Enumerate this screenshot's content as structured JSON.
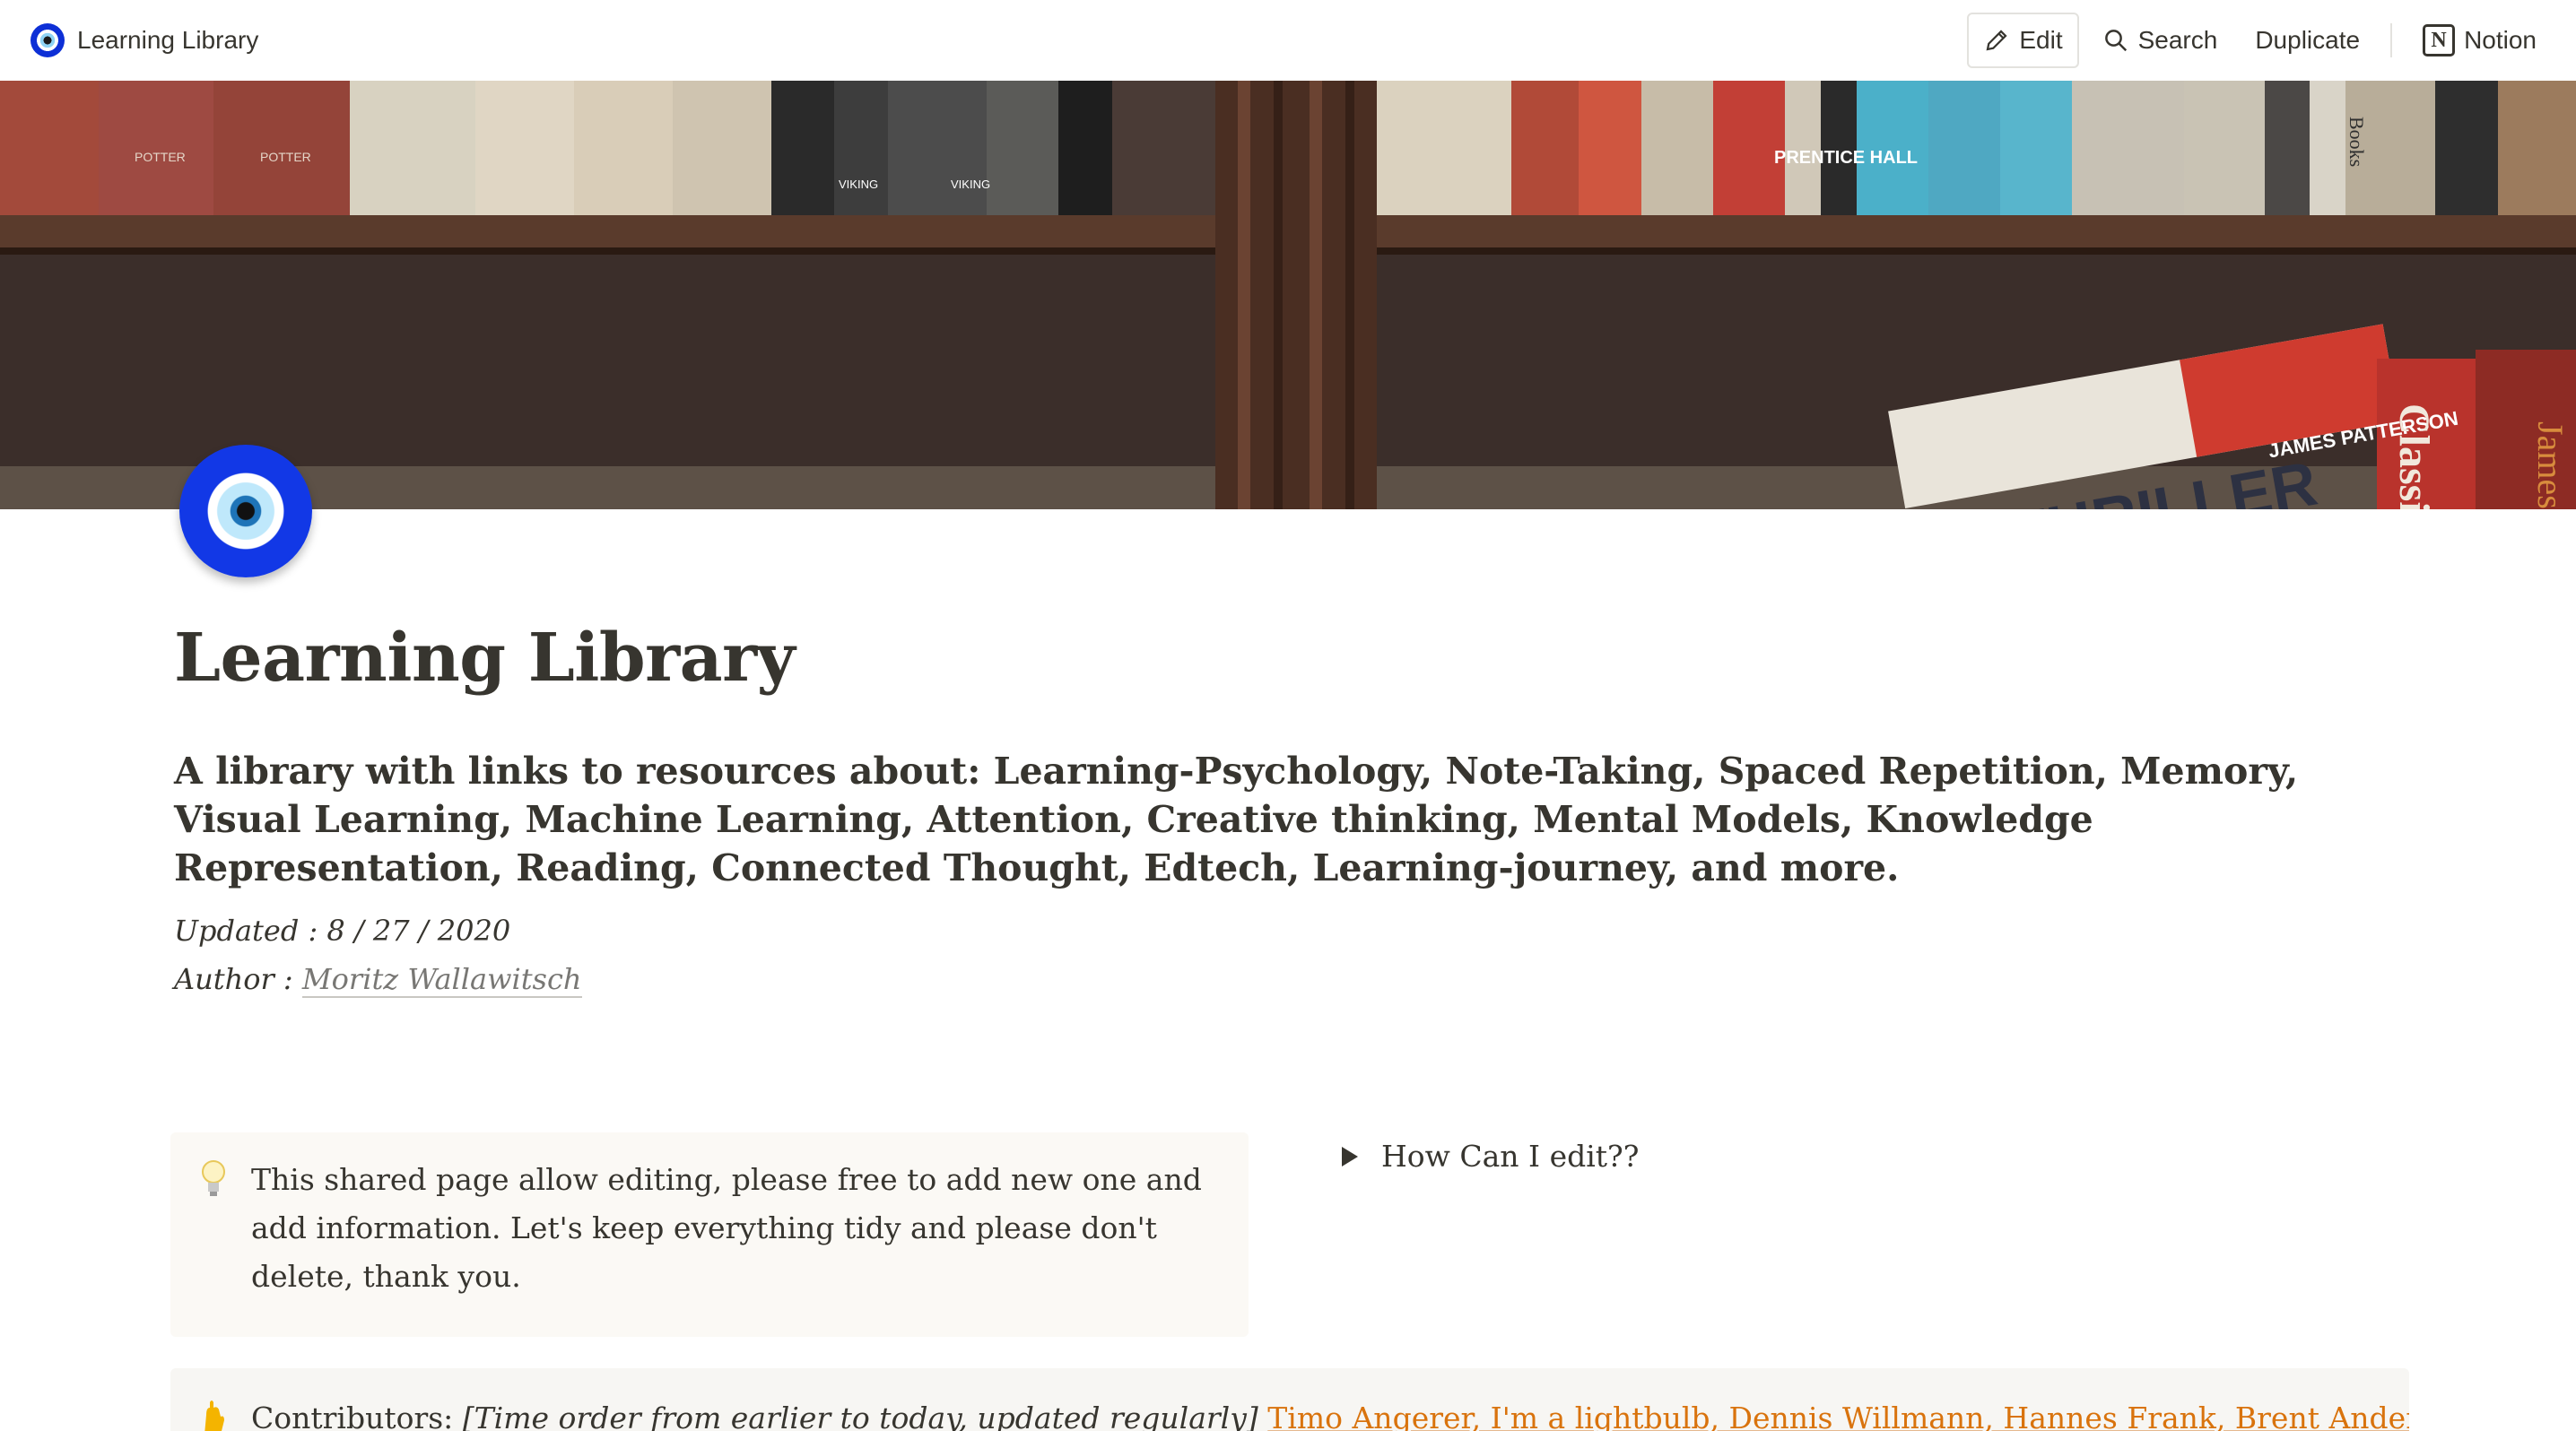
{
  "topbar": {
    "breadcrumb_title": "Learning Library",
    "edit_label": "Edit",
    "search_label": "Search",
    "duplicate_label": "Duplicate",
    "notion_label": "Notion"
  },
  "cover": {
    "book_labels": [
      "POTTER",
      "POTTER",
      "VIKING",
      "VIKING",
      "PRENTICE HALL",
      "Books",
      "THRILLER",
      "JAMES PATTERSON",
      "Classic",
      "James"
    ]
  },
  "page": {
    "title": "Learning Library",
    "subtitle": "A library with links to resources about: Learning-Psychology, Note-Taking, Spaced Repetition, Memory, Visual Learning, Machine Learning, Attention, Creative thinking, Mental Models, Knowledge Representation, Reading, Connected Thought, Edtech, Learning-journey, and more.",
    "updated_label": "Updated :",
    "updated_value": "8 / 27 / 2020",
    "author_label": "Author :",
    "author_name": "Moritz Wallawitsch"
  },
  "callout": {
    "icon": "lightbulb-icon",
    "text": "This shared page allow editing, please free to add new one and add information. Let's keep everything tidy and please don't delete, thank you."
  },
  "toggle": {
    "label": "How Can I edit??"
  },
  "contributors": {
    "icon": "raised-hand-icon",
    "label": "Contributors:",
    "note": "[Time order from earlier to today, updated regularly]",
    "names": "Timo Angerer, I'm a lightbulb, Dennis Willmann, Hannes Frank, Brent Anderson, Kejos Stargua,"
  },
  "colors": {
    "text": "#37352f",
    "link_orange": "#d9730d",
    "callout_bg": "#fbf9f5",
    "contrib_bg": "#f7f6f3"
  }
}
